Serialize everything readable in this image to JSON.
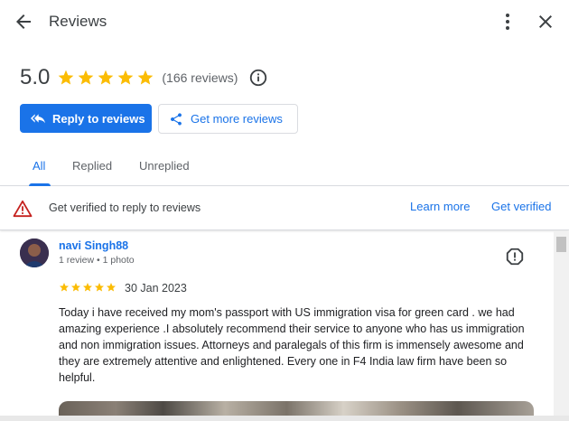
{
  "header": {
    "title": "Reviews",
    "back_icon": "arrow-back-icon",
    "more_icon": "more-vert-icon",
    "close_icon": "close-icon"
  },
  "rating": {
    "score": "5.0",
    "stars": 5,
    "count_text": "(166 reviews)",
    "star_color": "#fbbc04"
  },
  "actions": {
    "reply_label": "Reply to reviews",
    "reply_icon": "reply-all-icon",
    "get_more_label": "Get more reviews",
    "get_more_icon": "share-icon"
  },
  "tabs": [
    {
      "label": "All",
      "active": true
    },
    {
      "label": "Replied",
      "active": false
    },
    {
      "label": "Unreplied",
      "active": false
    }
  ],
  "banner": {
    "icon": "warning-icon",
    "text": "Get verified to reply to reviews",
    "learn_more": "Learn more",
    "get_verified": "Get verified"
  },
  "review": {
    "name": "navi Singh88",
    "meta": "1 review • 1 photo",
    "stars": 5,
    "date": "30 Jan 2023",
    "text": "Today i have received my mom's passport with US immigration visa for green card . we had amazing experience .I absolutely recommend their service to anyone who has us immigration and non immigration issues. Attorneys and paralegals of this firm is immensely awesome and they are extremely attentive and enlightened. Every one in F4 India law firm have been so helpful."
  },
  "colors": {
    "accent": "#1a73e8",
    "warning": "#c5221f",
    "text": "#3c4043"
  }
}
